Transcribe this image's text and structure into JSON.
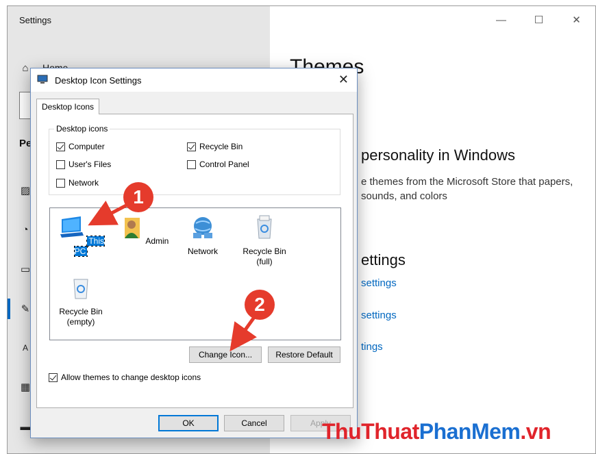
{
  "settings": {
    "title": "Settings",
    "controls": {
      "minimize": "—",
      "maximize": "☐",
      "close": "✕"
    },
    "sidebar": {
      "home_label": "Home",
      "heading": "Pe"
    },
    "content": {
      "title": "Themes",
      "personality": "personality in Windows",
      "store_text": "e themes from the Microsoft Store that papers, sounds, and colors",
      "settings_heading": "ettings",
      "links": [
        "settings",
        "settings",
        "tings"
      ]
    }
  },
  "dialog": {
    "title": "Desktop Icon Settings",
    "close": "✕",
    "tab": "Desktop Icons",
    "group_legend": "Desktop icons",
    "checkboxes": [
      {
        "label": "Computer",
        "checked": true
      },
      {
        "label": "Recycle Bin",
        "checked": true
      },
      {
        "label": "User's Files",
        "checked": false
      },
      {
        "label": "Control Panel",
        "checked": false
      },
      {
        "label": "Network",
        "checked": false
      }
    ],
    "icons": [
      {
        "label": "This PC",
        "selected": true
      },
      {
        "label": "Admin"
      },
      {
        "label": "Network"
      },
      {
        "label": "Recycle Bin\n(full)"
      },
      {
        "label": "Recycle Bin\n(empty)"
      }
    ],
    "change_icon_button": "Change Icon...",
    "restore_default_button": "Restore Default",
    "allow_themes_label": "Allow themes to change desktop icons",
    "allow_themes_checked": true,
    "ok_button": "OK",
    "cancel_button": "Cancel",
    "apply_button": "Apply"
  },
  "annotations": {
    "badge_1": "1",
    "badge_2": "2"
  },
  "watermark": {
    "part1": "ThuThuat",
    "part2": "PhanMem",
    "part3": ".vn"
  },
  "colors": {
    "annotation_red": "#e53b2c",
    "accent_blue": "#0078d7",
    "link_blue": "#0067c0"
  }
}
